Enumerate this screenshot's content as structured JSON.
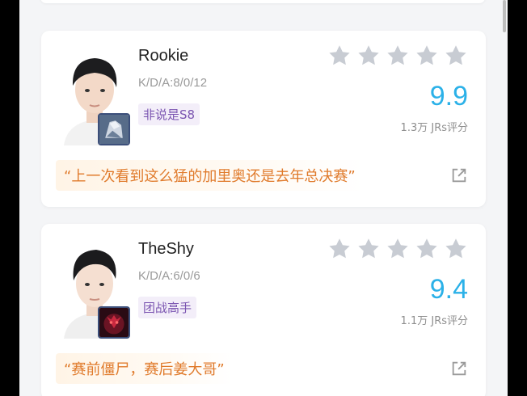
{
  "colors": {
    "score": "#2bb1e8",
    "tag_text": "#7b55b1",
    "tag_bg": "#f3eef9",
    "quote_text": "#e07b2c",
    "star": "#c8ccd3"
  },
  "players": [
    {
      "name": "Rookie",
      "kda": "K/D/A:8/0/12",
      "tag": "非说是S8",
      "rating_stars_filled": 0,
      "score": "9.9",
      "rating_count": "1.3万 JRs评分",
      "quote": "“上一次看到这么猛的加里奥还是去年总决赛”",
      "champion_icon": "galio-champion-icon"
    },
    {
      "name": "TheShy",
      "kda": "K/D/A:6/0/6",
      "tag": "团战高手",
      "rating_stars_filled": 0,
      "score": "9.4",
      "rating_count": "1.1万 JRs评分",
      "quote": "“赛前僵尸，赛后姜大哥”",
      "champion_icon": "champion-icon"
    }
  ]
}
